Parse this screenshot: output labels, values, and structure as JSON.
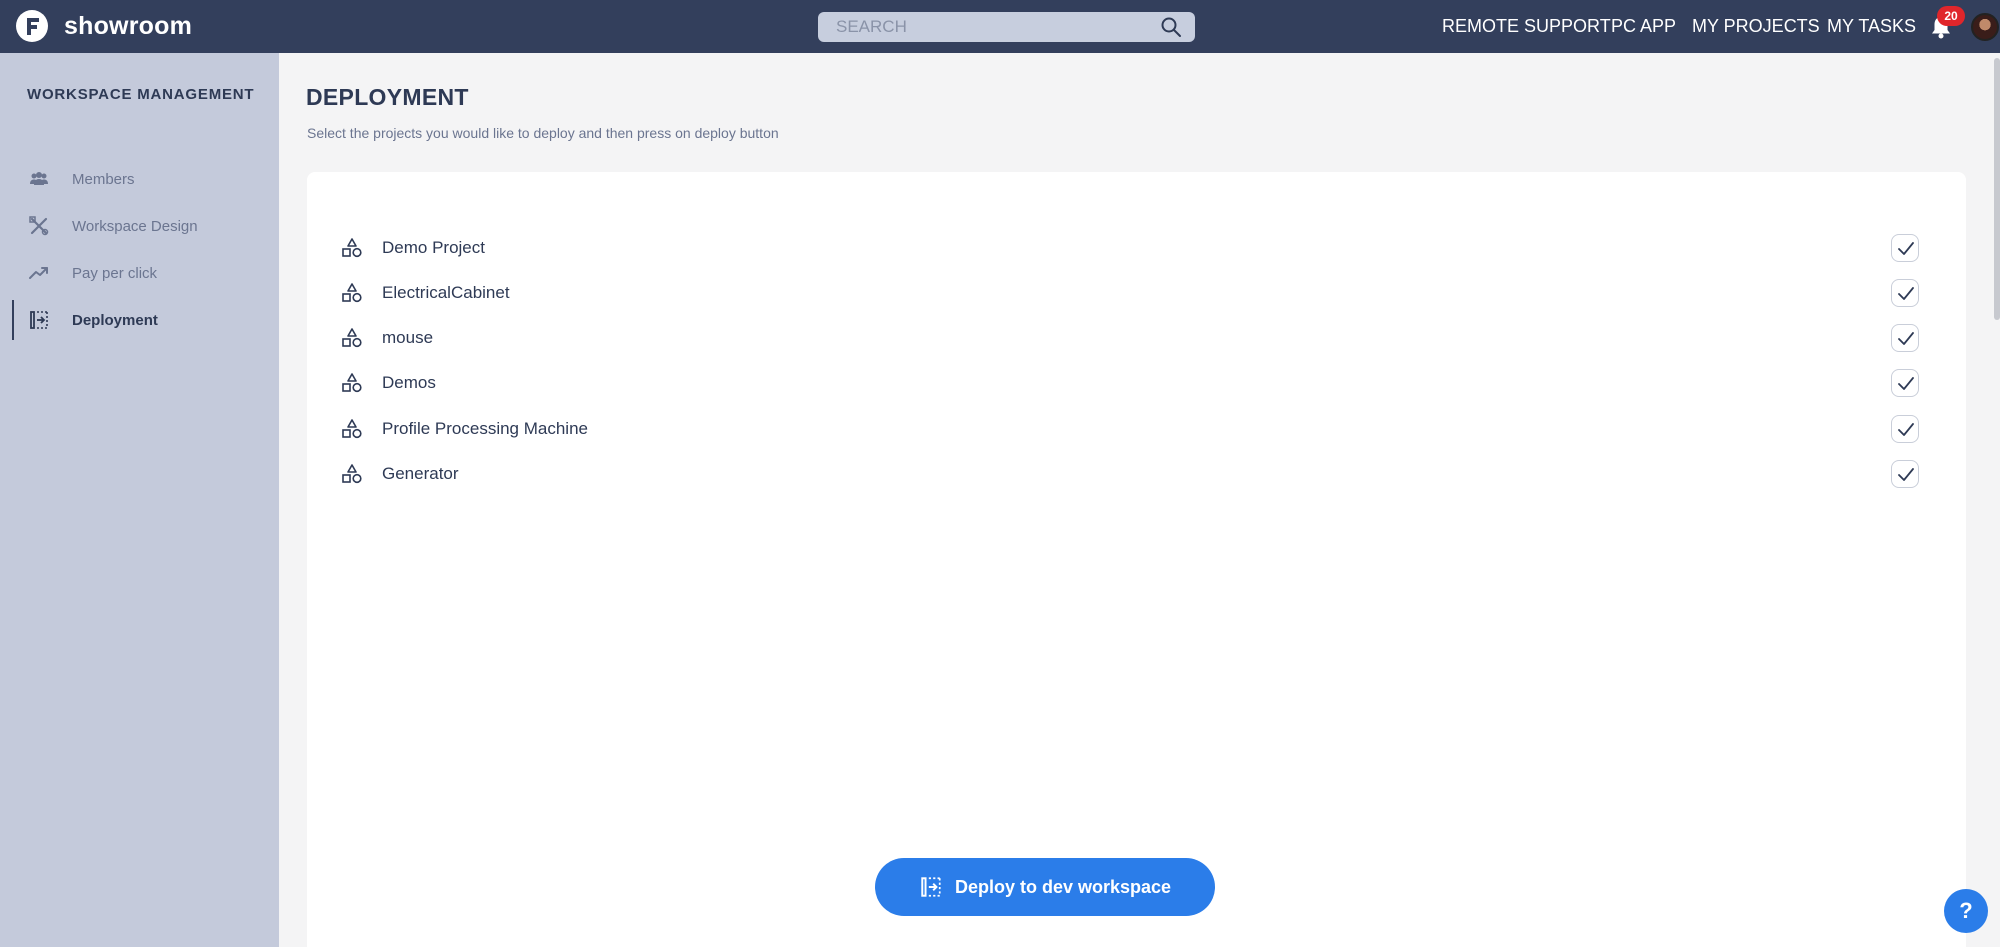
{
  "app": {
    "brand": "showroom"
  },
  "header": {
    "search_placeholder": "SEARCH",
    "links": [
      "REMOTE SUPPORT",
      "PC APP",
      "MY PROJECTS",
      "MY TASKS"
    ],
    "notification_count": "20"
  },
  "sidebar": {
    "title": "WORKSPACE MANAGEMENT",
    "items": [
      {
        "label": "Members",
        "icon": "members-icon"
      },
      {
        "label": "Workspace Design",
        "icon": "design-tools-icon"
      },
      {
        "label": "Pay per click",
        "icon": "trend-up-icon"
      },
      {
        "label": "Deployment",
        "icon": "deploy-icon",
        "active": true
      }
    ]
  },
  "main": {
    "title": "DEPLOYMENT",
    "subtitle": "Select the projects you would like to deploy and then press on deploy button",
    "projects": [
      {
        "name": "Demo Project",
        "checked": true
      },
      {
        "name": "ElectricalCabinet",
        "checked": true
      },
      {
        "name": "mouse",
        "checked": true
      },
      {
        "name": "Demos",
        "checked": true
      },
      {
        "name": "Profile Processing Machine",
        "checked": true
      },
      {
        "name": "Generator",
        "checked": true
      }
    ],
    "deploy_button_label": "Deploy to dev workspace",
    "help_label": "?"
  },
  "colors": {
    "topbar": "#333f5c",
    "sidebar": "#c4cadb",
    "accent": "#2b7de9",
    "badge": "#e0262b"
  }
}
